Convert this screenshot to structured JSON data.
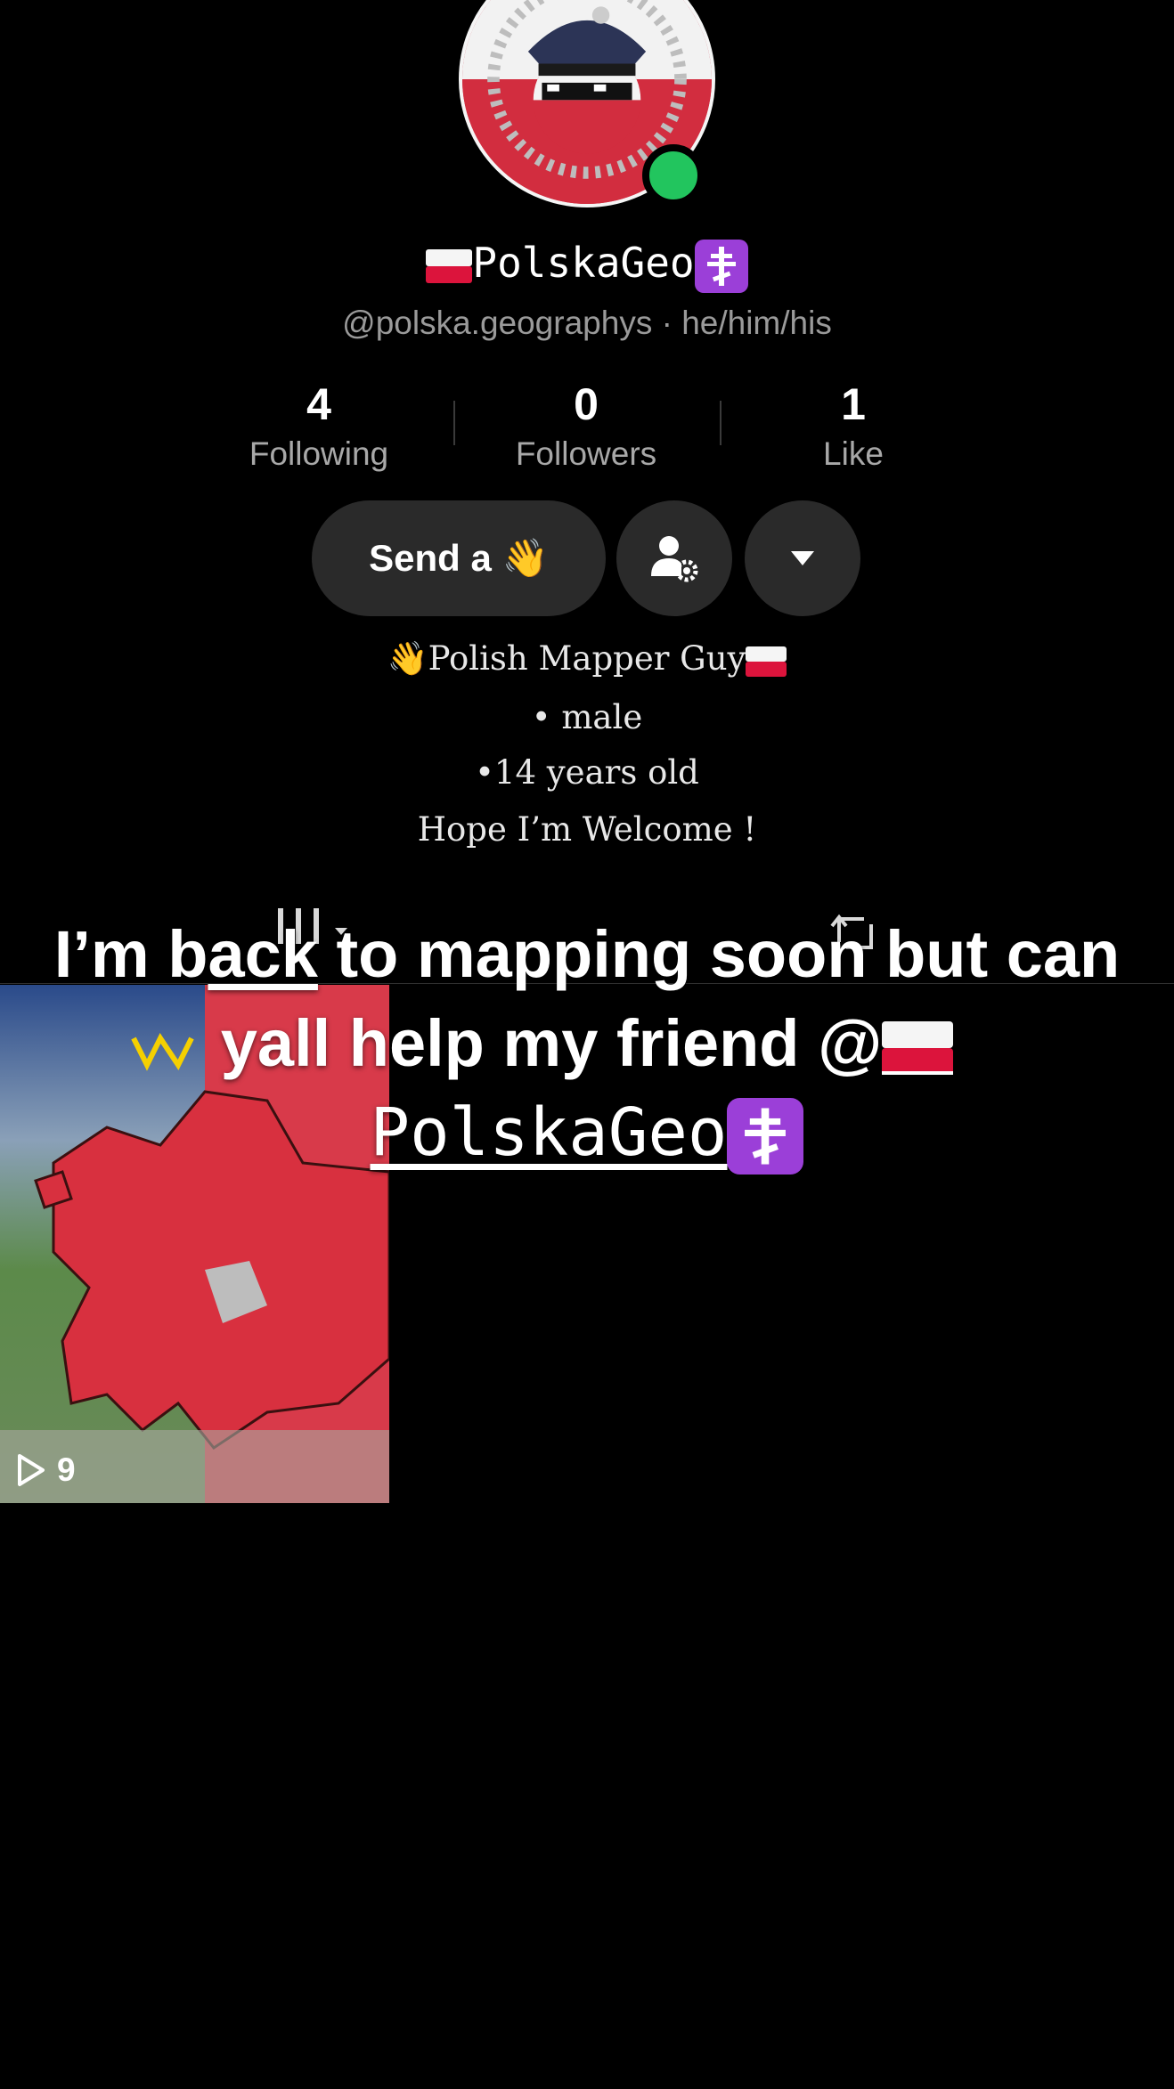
{
  "profile": {
    "display_name": "PolskaGeo",
    "handle_line": "@polska.geographys · he/him/his",
    "avatar_text": "Polska.Geo"
  },
  "stats": [
    {
      "value": "4",
      "label": "Following"
    },
    {
      "value": "0",
      "label": "Followers"
    },
    {
      "value": "1",
      "label": "Like"
    }
  ],
  "actions": {
    "send_label": "Send a 👋",
    "follow_settings_icon": "user-gear-icon",
    "more_icon": "triangle-down-icon"
  },
  "bio": {
    "line1": "Polish Mapper Guy",
    "line2": "• male",
    "line3": "•14 years old",
    "line4": "Hope I’m Welcome !"
  },
  "tabs": {
    "grid_icon": "grid-icon",
    "repost_icon": "repost-icon"
  },
  "video": {
    "views": "9",
    "play_icon": "play-icon"
  },
  "overlay": {
    "part1": "I’m b",
    "part2": "ack",
    "part3": " to mapping soon but can yall help my friend @",
    "mention": "PolskaGeo"
  },
  "colors": {
    "background": "#000000",
    "online": "#22c55e",
    "button_bg": "#2a2a2a",
    "flag_red": "#dc143c"
  }
}
